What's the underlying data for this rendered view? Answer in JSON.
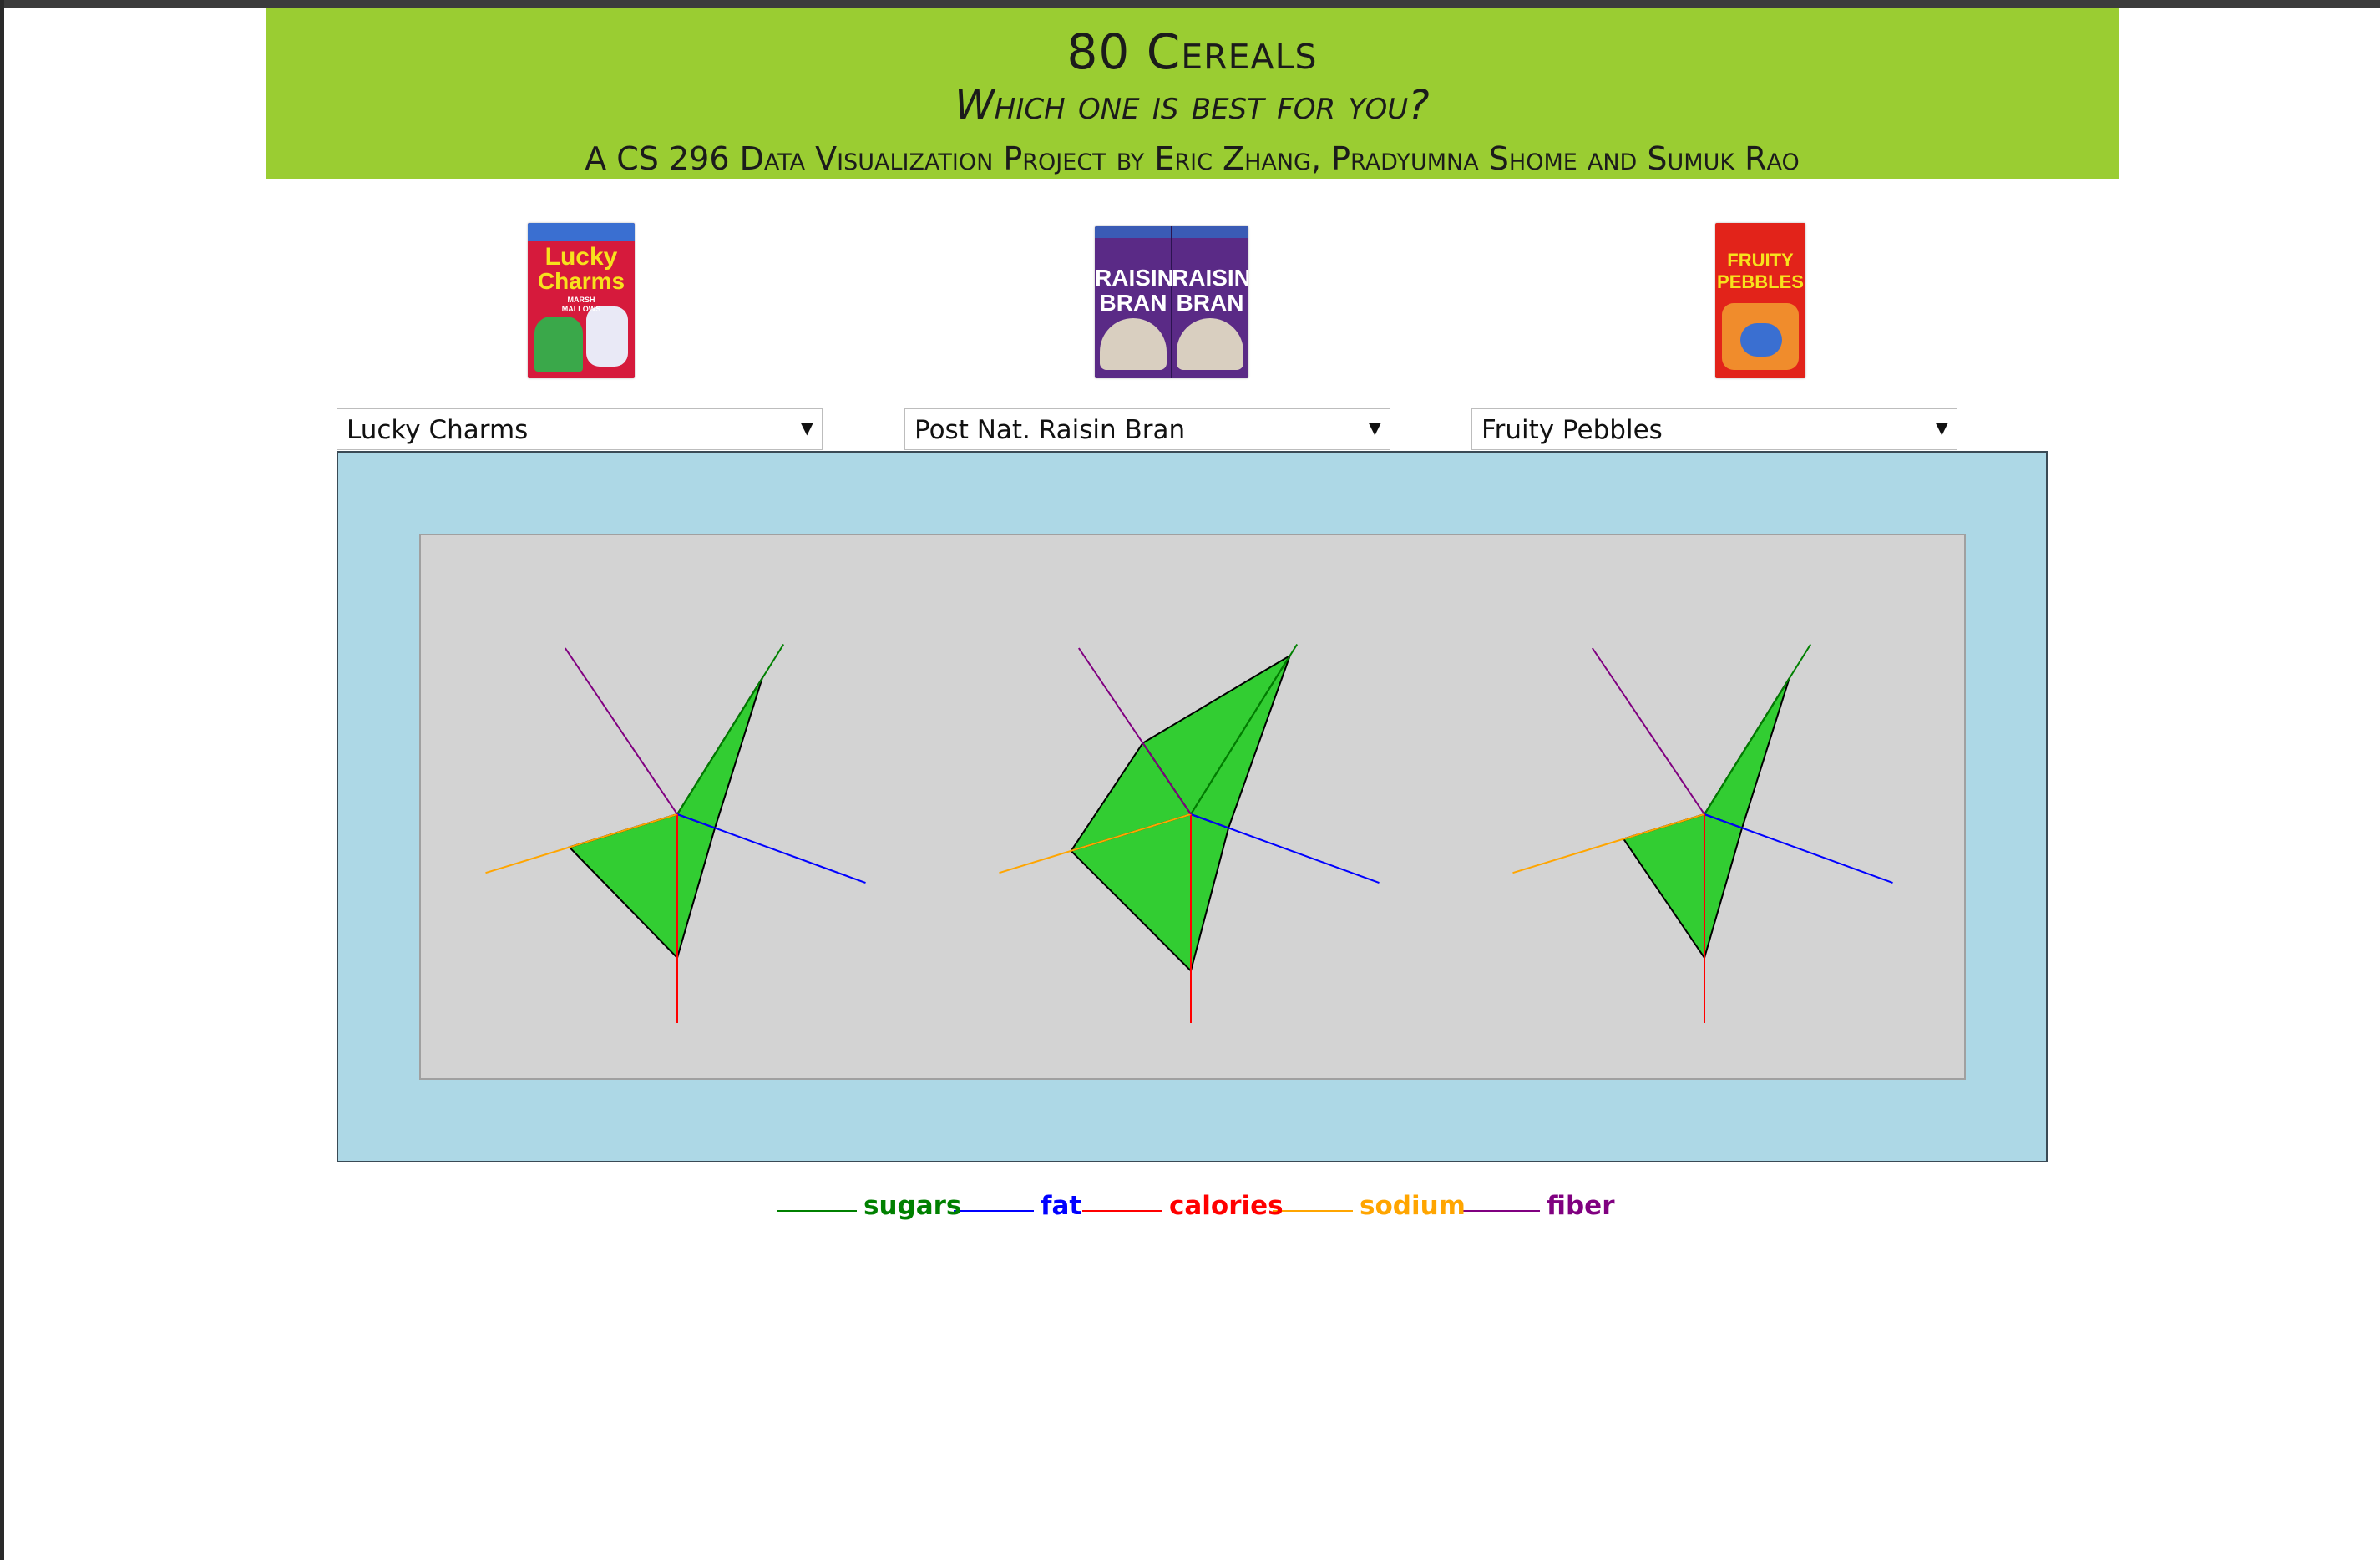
{
  "header": {
    "title": "80 Cereals",
    "subtitle": "Which one is best for you?",
    "credit": "A CS 296 Data Visualization Project by Eric Zhang, Pradyumna Shome and Sumuk Rao"
  },
  "cereals": [
    {
      "selected": "Lucky Charms",
      "box_text": [
        "Lucky",
        "Charms",
        "MARSH",
        "MALLOWS"
      ],
      "box_colors": {
        "primary": "#d61a3c",
        "secondary": "#3a6fd1",
        "accent": "#f7e21d"
      },
      "values": {
        "sugars": 12,
        "fat": 1,
        "calories": 110,
        "sodium": 180,
        "fiber": 0
      }
    },
    {
      "selected": "Post Nat. Raisin Bran",
      "box_text": [
        "RAISIN",
        "BRAN",
        "RAISIN",
        "BRAN"
      ],
      "box_colors": {
        "primary": "#5a2a86",
        "secondary": "#3a5bb5",
        "accent": "#8a5a2b"
      },
      "values": {
        "sugars": 14,
        "fat": 1,
        "calories": 120,
        "sodium": 200,
        "fiber": 6
      }
    },
    {
      "selected": "Fruity Pebbles",
      "box_text": [
        "FRUITY",
        "PEBBLES"
      ],
      "box_colors": {
        "primary": "#e2231a",
        "secondary": "#f7b500",
        "accent": "#2a9d4a"
      },
      "values": {
        "sugars": 12,
        "fat": 1,
        "calories": 110,
        "sodium": 135,
        "fiber": 0
      }
    }
  ],
  "chart_data": {
    "type": "radar",
    "axes": [
      {
        "name": "sugars",
        "color": "#008000",
        "max": 15
      },
      {
        "name": "fat",
        "color": "#0000ff",
        "max": 5
      },
      {
        "name": "calories",
        "color": "#ff0000",
        "max": 160
      },
      {
        "name": "sodium",
        "color": "#ffa500",
        "max": 320
      },
      {
        "name": "fiber",
        "color": "#800080",
        "max": 14
      }
    ],
    "series": [
      {
        "values": [
          12,
          1,
          110,
          180,
          0
        ]
      },
      {
        "values": [
          14,
          1,
          120,
          200,
          6
        ]
      },
      {
        "values": [
          12,
          1,
          110,
          135,
          0
        ]
      }
    ],
    "fill_color": "#32cd32",
    "plot_background": "#d3d3d3",
    "stage_background": "#add8e6"
  },
  "legend": [
    "sugars",
    "fat",
    "calories",
    "sodium",
    "fiber"
  ],
  "colors": {
    "header_bg": "#9acd32",
    "stage": "#add8e6",
    "plot": "#d3d3d3",
    "fill": "#32cd32"
  }
}
